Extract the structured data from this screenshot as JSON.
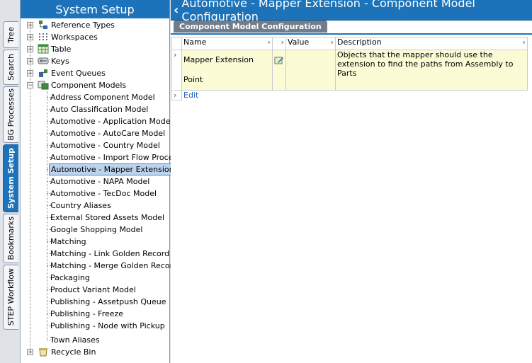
{
  "vertical_tabs": [
    {
      "label": "Tree",
      "active": false
    },
    {
      "label": "Search",
      "active": false
    },
    {
      "label": "BG Processes",
      "active": false
    },
    {
      "label": "System Setup",
      "active": true
    },
    {
      "label": "Bookmarks",
      "active": false
    },
    {
      "label": "STEP Workflow",
      "active": false
    }
  ],
  "left_panel": {
    "title": "System Setup",
    "top_nodes": [
      "Reference Types",
      "Workspaces",
      "Table",
      "Keys",
      "Event Queues",
      "Component Models"
    ],
    "component_models": [
      "Address Component Model",
      "Auto Classification Model",
      "Automotive - Application Model",
      "Automotive - AutoCare Model",
      "Automotive - Country Model",
      "Automotive - Import Flow Process",
      "Automotive - Mapper Extension",
      "Automotive - NAPA Model",
      "Automotive - TecDoc Model",
      "Country Aliases",
      "External Stored Assets Model",
      "Google Shopping Model",
      "Matching",
      "Matching - Link Golden Record",
      "Matching - Merge Golden Record",
      "Packaging",
      "Product Variant Model",
      "Publishing - Assetpush Queue",
      "Publishing - Freeze",
      "Publishing - Node with Pickup",
      "Town Aliases"
    ],
    "bottom_node": "Recycle Bin",
    "selected": "Automotive - Mapper Extension"
  },
  "right_panel": {
    "title": "Automotive - Mapper Extension - Component Model Configuration",
    "tab": "Component Model Configuration",
    "columns": {
      "name": "Name",
      "value": "Value",
      "description": "Description"
    },
    "rows": [
      {
        "name": "Mapper Extension Point",
        "value": "",
        "description": "Objects that the mapper should use the extension to find the paths from Assembly to Parts"
      }
    ],
    "edit_label": "Edit"
  },
  "colors": {
    "accent": "#1d73b9",
    "selection": "#bcd3ee",
    "row_highlight": "#fbfbd6"
  }
}
